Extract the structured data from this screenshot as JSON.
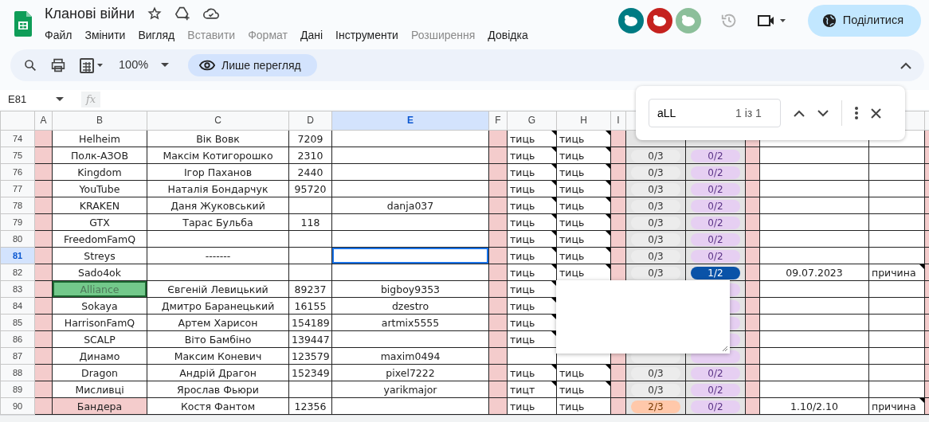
{
  "document": {
    "title": "Кланові війни"
  },
  "menu": [
    {
      "label": "Файл",
      "disabled": false
    },
    {
      "label": "Змінити",
      "disabled": false
    },
    {
      "label": "Вигляд",
      "disabled": false
    },
    {
      "label": "Вставити",
      "disabled": true
    },
    {
      "label": "Формат",
      "disabled": true
    },
    {
      "label": "Дані",
      "disabled": false
    },
    {
      "label": "Інструменти",
      "disabled": false
    },
    {
      "label": "Розширення",
      "disabled": true
    },
    {
      "label": "Довідка",
      "disabled": false
    }
  ],
  "avatars": [
    {
      "color": "#007b83"
    },
    {
      "color": "#c5221f"
    },
    {
      "color": "#8cbf9a"
    }
  ],
  "share_button": "Поділитися",
  "toolbar": {
    "zoom": "100%",
    "mode": "Лише перегляд"
  },
  "formula_bar": {
    "cell_ref": "E81",
    "function_label": "fx"
  },
  "find": {
    "query": "aLL",
    "count": "1 із 1"
  },
  "columns": [
    {
      "label": "A",
      "kind": "spacer",
      "selected": false
    },
    {
      "label": "B",
      "kind": "text",
      "selected": false
    },
    {
      "label": "C",
      "kind": "text",
      "selected": false
    },
    {
      "label": "D",
      "kind": "text",
      "selected": false
    },
    {
      "label": "E",
      "kind": "text",
      "selected": true
    },
    {
      "label": "F",
      "kind": "spacer",
      "selected": false
    },
    {
      "label": "G",
      "kind": "left",
      "selected": false
    },
    {
      "label": "H",
      "kind": "left",
      "selected": false
    },
    {
      "label": "I",
      "kind": "spacer",
      "selected": false
    },
    {
      "kind": "pill"
    },
    {
      "kind": "pill"
    },
    {
      "kind": "spacer"
    },
    {
      "kind": "text"
    },
    {
      "kind": "left"
    },
    {
      "kind": "spacer"
    }
  ],
  "rows": [
    {
      "number": "74",
      "selected": false,
      "cells": {
        "B": "Helheim",
        "C": "Вік Вовк",
        "D": "7209",
        "G": {
          "text": "тиць",
          "note": true
        },
        "H": {
          "text": "тиць",
          "note": true
        }
      }
    },
    {
      "number": "75",
      "selected": false,
      "cells": {
        "B": "Полк-АЗОВ",
        "C": "Максім Котигорошко",
        "D": "2310",
        "G": {
          "text": "тиць",
          "note": true
        },
        "H": {
          "text": "тиць",
          "note": true
        },
        "J": {
          "text": "0/3",
          "color": "#ececec"
        },
        "K": {
          "text": "0/2",
          "color": "#e6cff2"
        }
      }
    },
    {
      "number": "76",
      "selected": false,
      "cells": {
        "B": "Kingdom",
        "C": "Ігор Паханов",
        "D": "2440",
        "G": {
          "text": "тиць",
          "note": true
        },
        "H": {
          "text": "тиць",
          "note": true
        },
        "J": {
          "text": "0/3",
          "color": "#ececec"
        },
        "K": {
          "text": "0/2",
          "color": "#e6cff2"
        }
      }
    },
    {
      "number": "77",
      "selected": false,
      "cells": {
        "B": "YouTube",
        "C": "Наталія Бондарчук",
        "D": "95720",
        "G": {
          "text": "тиць",
          "note": true
        },
        "H": {
          "text": "тиць",
          "note": true
        },
        "J": {
          "text": "0/3",
          "color": "#ececec"
        },
        "K": {
          "text": "0/2",
          "color": "#e6cff2"
        }
      }
    },
    {
      "number": "78",
      "selected": false,
      "cells": {
        "B": "KRAKEN",
        "C": "Даня Жуковський",
        "E": "danja037",
        "G": {
          "text": "тиць",
          "note": true
        },
        "H": {
          "text": "тиць",
          "note": true
        },
        "J": {
          "text": "0/3",
          "color": "#ececec"
        },
        "K": {
          "text": "0/2",
          "color": "#e6cff2"
        }
      }
    },
    {
      "number": "79",
      "selected": false,
      "cells": {
        "B": "GTX",
        "C": "Тарас Бульба",
        "D": "118",
        "G": {
          "text": "тиць",
          "note": true
        },
        "H": {
          "text": "тиць",
          "note": true
        },
        "J": {
          "text": "0/3",
          "color": "#ececec"
        },
        "K": {
          "text": "0/2",
          "color": "#e6cff2"
        }
      }
    },
    {
      "number": "80",
      "selected": false,
      "cells": {
        "B": "FreedomFamQ",
        "G": {
          "text": "тиць",
          "note": true
        },
        "H": {
          "text": "тиць",
          "note": true
        },
        "J": {
          "text": "0/3",
          "color": "#ececec"
        },
        "K": {
          "text": "0/2",
          "color": "#e6cff2"
        }
      }
    },
    {
      "number": "81",
      "selected": true,
      "cells": {
        "B": "Streys",
        "C": "-------",
        "E": {
          "selected": true
        },
        "G": {
          "text": "тиць",
          "note": true
        },
        "H": {
          "text": "тиць",
          "note": true
        },
        "J": {
          "text": "0/3",
          "color": "#ececec"
        },
        "K": {
          "text": "0/2",
          "color": "#e6cff2"
        }
      }
    },
    {
      "number": "82",
      "selected": false,
      "cells": {
        "B": "Sado4ok",
        "G": {
          "text": "тиць",
          "note": true
        },
        "H": {
          "text": "тиць",
          "note": true
        },
        "J": {
          "text": "0/3",
          "color": "#ececec"
        },
        "K": {
          "text": "1/2",
          "color": "#0a53a8"
        },
        "M": "09.07.2023",
        "N": {
          "text": "причина",
          "note": true
        }
      }
    },
    {
      "number": "83",
      "selected": false,
      "cells": {
        "B": {
          "text": "Alliance",
          "color": "#73c98b",
          "matched": true
        },
        "C": "Євгеній Левицький",
        "D": "89237",
        "E": "bigboy9353",
        "G": {
          "text": "тиць",
          "note": true
        },
        "K": {
          "color": "#e6cff2"
        }
      }
    },
    {
      "number": "84",
      "selected": false,
      "cells": {
        "B": "Sokaya",
        "C": "Дмитро Баранецький",
        "D": "16155",
        "E": "dzestro",
        "G": {
          "text": "тиць",
          "note": true
        },
        "K": {
          "color": "#e6cff2"
        }
      }
    },
    {
      "number": "85",
      "selected": false,
      "cells": {
        "B": "HarrisonFamQ",
        "C": "Артем Харисон",
        "D": "154189",
        "E": "artmix5555",
        "G": {
          "text": "тиць",
          "note": true
        },
        "K": {
          "color": "#e6cff2"
        }
      }
    },
    {
      "number": "86",
      "selected": false,
      "cells": {
        "B": "SCALP",
        "C": "Віто Бамбіно",
        "D": "139447",
        "G": {
          "text": "тиць",
          "note": true
        },
        "K": {
          "color": "#e6cff2"
        }
      }
    },
    {
      "number": "87",
      "selected": false,
      "cells": {
        "B": "Динамо",
        "C": "Максим Коневич",
        "D": "123579",
        "E": "maxim0494",
        "J": {
          "color": "#ececec"
        },
        "K": {
          "color": "#e6cff2"
        }
      }
    },
    {
      "number": "88",
      "selected": false,
      "cells": {
        "B": "Dragon",
        "C": "Андрій Драгон",
        "D": "152349",
        "E": "pixel7222",
        "G": {
          "text": "тиць",
          "note": true
        },
        "H": {
          "text": "тиць",
          "note": true
        },
        "J": {
          "text": "0/3",
          "color": "#ececec"
        },
        "K": {
          "text": "0/2",
          "color": "#e6cff2"
        }
      }
    },
    {
      "number": "89",
      "selected": false,
      "cells": {
        "B": "Мисливці",
        "C": "Ярослав Фьюри",
        "E": "yarikmajor",
        "G": {
          "text": "тицт",
          "note": true
        },
        "H": {
          "text": "тиць",
          "note": true
        },
        "J": {
          "text": "0/3",
          "color": "#ececec"
        },
        "K": {
          "text": "0/2",
          "color": "#e6cff2"
        }
      }
    },
    {
      "number": "90",
      "selected": false,
      "cells": {
        "B": {
          "text": "Бандера",
          "color": "#f4cccc"
        },
        "C": "Костя Фантом",
        "D": "12356",
        "G": "тиць",
        "H": "тиць",
        "J": {
          "text": "2/3",
          "color": "#ffc8aa"
        },
        "K": {
          "text": "0/2",
          "color": "#e6cff2"
        },
        "M": "1.10/2.10",
        "N": {
          "text": "причина",
          "note": true
        }
      }
    }
  ],
  "comment_box": {
    "kind": "empty"
  }
}
